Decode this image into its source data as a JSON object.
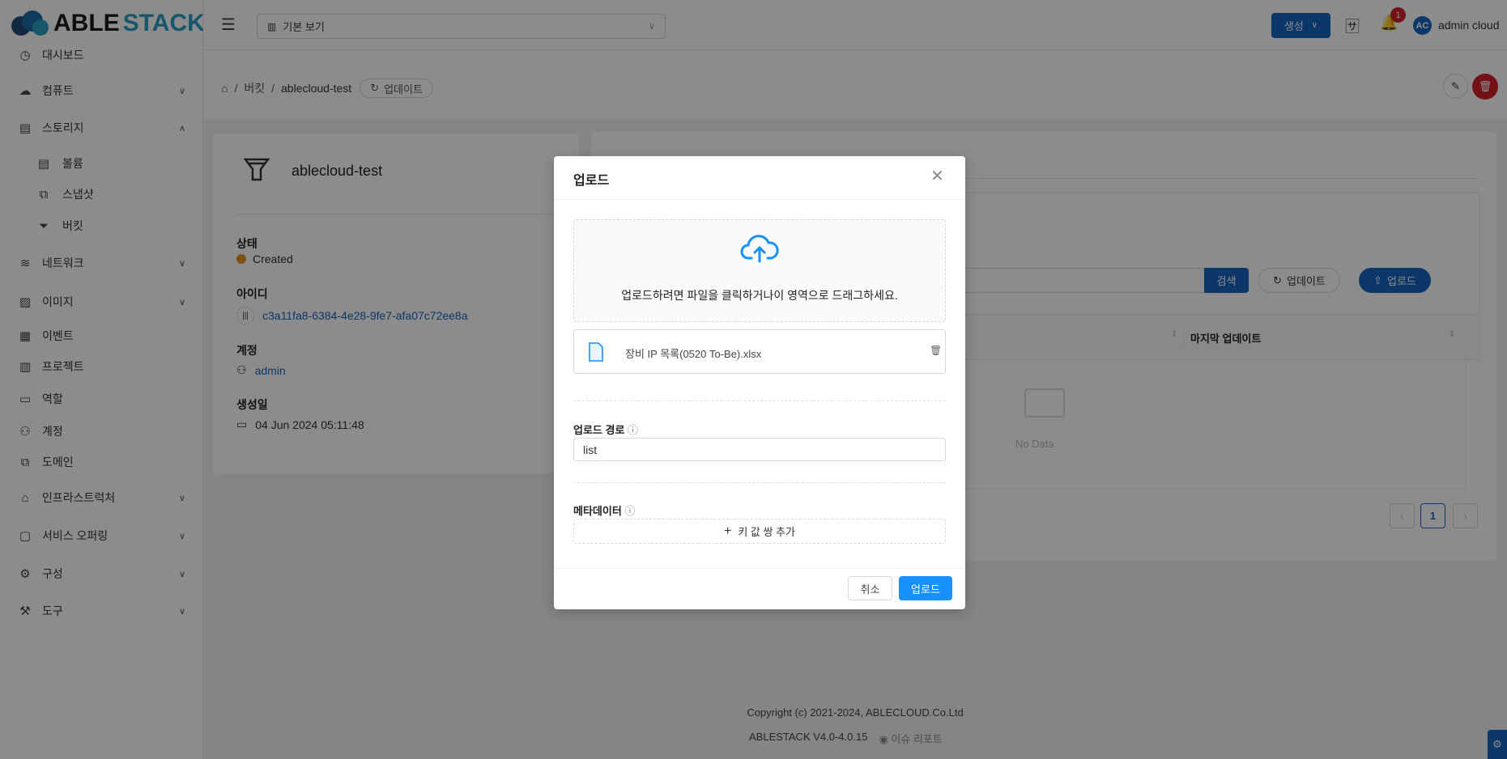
{
  "logo": {
    "part1": "ABLE",
    "part2": "STACK"
  },
  "header": {
    "view_select": "기본 보기",
    "create_label": "생성",
    "notification_count": "1",
    "avatar_initials": "AC",
    "user_name": "admin cloud"
  },
  "breadcrumb": {
    "level1": "버킷",
    "level2": "ablecloud-test",
    "refresh_label": "업데이트"
  },
  "sidebar": {
    "items": [
      {
        "label": "대시보드",
        "icon": "dashboard-icon"
      },
      {
        "label": "컴퓨트",
        "icon": "cloud-icon"
      },
      {
        "label": "스토리지",
        "icon": "storage-icon"
      },
      {
        "label": "볼륨",
        "icon": "volume-icon"
      },
      {
        "label": "스냅샷",
        "icon": "snapshot-icon"
      },
      {
        "label": "버킷",
        "icon": "bucket-icon"
      },
      {
        "label": "네트워크",
        "icon": "wifi-icon"
      },
      {
        "label": "이미지",
        "icon": "image-icon"
      },
      {
        "label": "이벤트",
        "icon": "calendar-icon"
      },
      {
        "label": "프로젝트",
        "icon": "project-icon"
      },
      {
        "label": "역할",
        "icon": "idcard-icon"
      },
      {
        "label": "계정",
        "icon": "users-icon"
      },
      {
        "label": "도메인",
        "icon": "domain-icon"
      },
      {
        "label": "인프라스트럭처",
        "icon": "bank-icon"
      },
      {
        "label": "서비스 오퍼링",
        "icon": "shopping-icon"
      },
      {
        "label": "구성",
        "icon": "gear-icon"
      },
      {
        "label": "도구",
        "icon": "tool-icon"
      }
    ]
  },
  "detail": {
    "name": "ablecloud-test",
    "status_label": "상태",
    "status": "Created",
    "status_color": "#e8941a",
    "id_label": "아이디",
    "id": "c3a11fa8-6384-4e28-9fe7-afa07c72ee8a",
    "account_label": "계정",
    "account": "admin",
    "created_label": "생성일",
    "created": "04 Jun 2024 05:11:48"
  },
  "objects": {
    "search_label": "검색",
    "refresh_label": "업데이트",
    "upload_label": "업로드",
    "col_last_update": "마지막 업데이트",
    "empty": "No Data",
    "page": "1"
  },
  "modal": {
    "title": "업로드",
    "drop_text": "업로드하려면 파일을 클릭하거나이 영역으로 드래그하세요.",
    "file_name": "장비 IP 목록(0520 To-Be).xlsx",
    "path_label": "업로드 경로",
    "path_value": "list",
    "metadata_label": "메타데이터",
    "add_pair_label": "키 값 쌍 추가",
    "cancel_label": "취소",
    "submit_label": "업로드"
  },
  "footer": {
    "copyright": "Copyright (c) 2021-2024, ABLECLOUD.Co.Ltd",
    "version": "ABLESTACK V4.0-4.0.15",
    "issue_label": "이슈 리포트"
  },
  "colors": {
    "primary": "#1565c0",
    "modal_primary": "#1890ff",
    "danger": "#d32029"
  }
}
